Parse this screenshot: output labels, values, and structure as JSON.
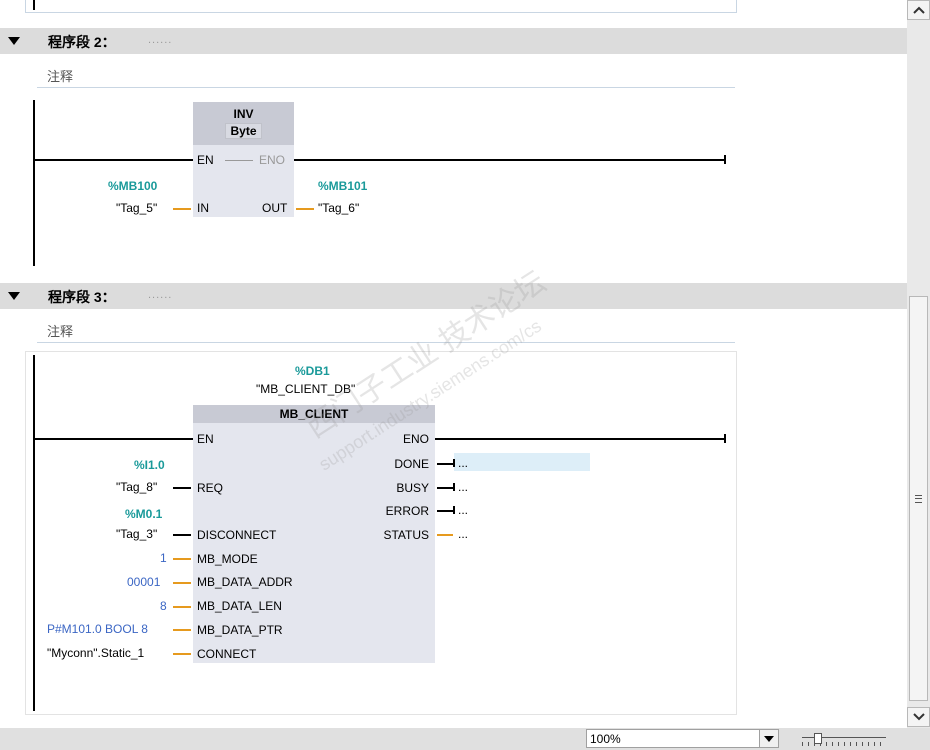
{
  "segments": [
    {
      "title": "程序段 2：",
      "dots": "......",
      "comment": "注释"
    },
    {
      "title": "程序段 3：",
      "dots": "......",
      "comment": "注释"
    }
  ],
  "inv_block": {
    "name": "INV",
    "type": "Byte",
    "en": "EN",
    "eno": "ENO",
    "in_label": "IN",
    "out_label": "OUT",
    "in_addr": "%MB100",
    "in_tag": "\"Tag_5\"",
    "out_addr": "%MB101",
    "out_tag": "\"Tag_6\""
  },
  "mb_block": {
    "db_addr": "%DB1",
    "db_name": "\"MB_CLIENT_DB\"",
    "name": "MB_CLIENT",
    "en": "EN",
    "eno": "ENO",
    "inputs": [
      {
        "label": "REQ",
        "addr": "%I1.0",
        "tag": "\"Tag_8\""
      },
      {
        "label": "DISCONNECT",
        "addr": "%M0.1",
        "tag": "\"Tag_3\""
      },
      {
        "label": "MB_MODE",
        "value": "1"
      },
      {
        "label": "MB_DATA_ADDR",
        "value": "00001"
      },
      {
        "label": "MB_DATA_LEN",
        "value": "8"
      },
      {
        "label": "MB_DATA_PTR",
        "value": "P#M101.0 BOOL 8"
      },
      {
        "label": "CONNECT",
        "value": "\"Myconn\".Static_1"
      }
    ],
    "outputs": [
      {
        "label": "DONE",
        "value": "..."
      },
      {
        "label": "BUSY",
        "value": "..."
      },
      {
        "label": "ERROR",
        "value": "..."
      },
      {
        "label": "STATUS",
        "value": "..."
      }
    ]
  },
  "watermark": {
    "line1": "西门子工业 技术论坛",
    "line2": "support.industry.siemens.com/cs"
  },
  "statusbar": {
    "zoom": "100%"
  },
  "colors": {
    "header_bg": "#dcdcdc",
    "block_bg": "#e4e6ee",
    "tag_addr": "#1a9a9a",
    "constant": "#3b66c4",
    "wire_orange": "#e69a1e"
  }
}
